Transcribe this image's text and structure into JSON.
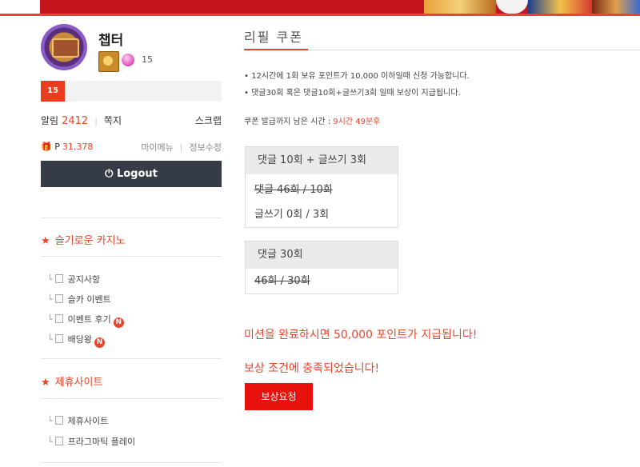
{
  "profile": {
    "username": "챕터",
    "level": "15",
    "level_bar_label": "15",
    "alarm_label": "알림",
    "alarm_count": "2412",
    "message_label": "쪽지",
    "scrap_label": "스크랩",
    "point_label": "P",
    "point_value": "31,378",
    "mymenu_label": "마이메뉴",
    "edit_info_label": "정보수정",
    "logout_label": "Logout"
  },
  "sidebar": {
    "sections": [
      {
        "title": "슬기로운 카지노",
        "items": [
          {
            "label": "공지사항",
            "new": ""
          },
          {
            "label": "슬카 이벤트",
            "new": ""
          },
          {
            "label": "이벤트 후기",
            "new": "N"
          },
          {
            "label": "배당왕",
            "new": "N"
          }
        ]
      },
      {
        "title": "제휴사이트",
        "items": [
          {
            "label": "제휴사이트",
            "new": ""
          },
          {
            "label": "프라그마틱 플레이",
            "new": ""
          }
        ]
      }
    ]
  },
  "main": {
    "title": "리필 쿠폰",
    "notices": [
      "• 12시간에 1회 보유 포인트가 10,000 이하일때 신청 가능합니다.",
      "• 댓글30회 혹은 댓글10회+글쓰기3회 일때 보상이 지급됩니다."
    ],
    "remain_label": "쿠폰 발급까지 남은 시간 :",
    "remain_time": "9시간 49분후",
    "box1": {
      "header": "댓글 10회 + 글쓰기 3회",
      "rows": [
        "댓글 46회 / 10회",
        "글쓰기 0회 / 3회"
      ]
    },
    "box2": {
      "header": "댓글 30회",
      "rows": [
        "46회 / 30회"
      ]
    },
    "mission_msg": "미션을 완료하시면 50,000 포인트가 지급됩니다!",
    "complete_msg": "보상 조건에 충족되었습니다!",
    "request_button": "보상요청"
  },
  "colors": {
    "accent": "#e8452c",
    "button_red": "#e8120c",
    "logout_bg": "#353c46"
  }
}
